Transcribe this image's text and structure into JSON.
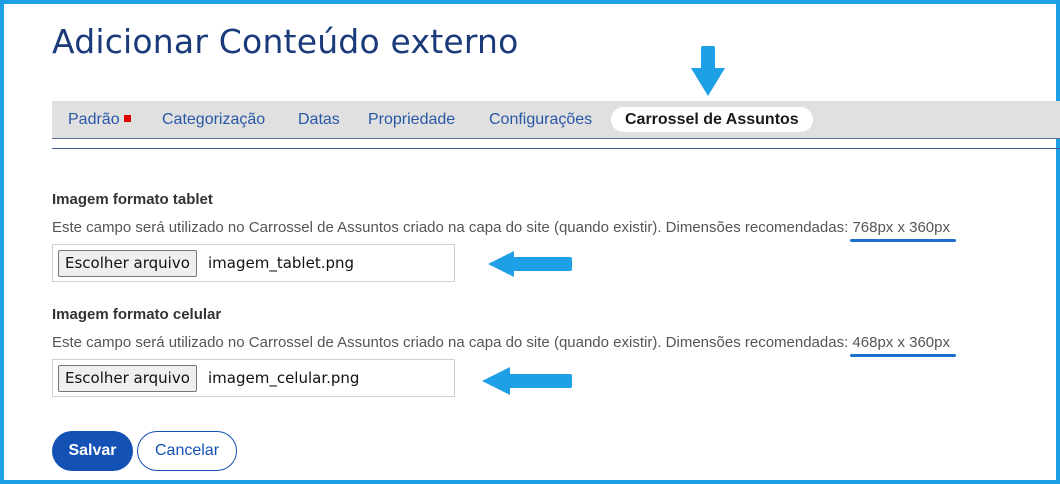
{
  "page": {
    "title": "Adicionar Conteúdo externo"
  },
  "tabs": [
    {
      "label": "Padrão",
      "required_marker": true
    },
    {
      "label": "Categorização"
    },
    {
      "label": "Datas"
    },
    {
      "label": "Propriedade"
    },
    {
      "label": "Configurações"
    },
    {
      "label": "Carrossel de Assuntos",
      "active": true
    }
  ],
  "fields": [
    {
      "label": "Imagem formato tablet",
      "help_prefix": "Este campo será utilizado no Carrossel de Assuntos criado na capa do site (quando existir). Dimensões recomendadas: ",
      "help_dimensions": "768px x 360px",
      "file_button_label": "Escolher arquivo",
      "file_name": "imagem_tablet.png"
    },
    {
      "label": "Imagem formato celular",
      "help_prefix": "Este campo será utilizado no Carrossel de Assuntos criado na capa do site (quando existir). Dimensões recomendadas: ",
      "help_dimensions": "468px x 360px",
      "file_button_label": "Escolher arquivo",
      "file_name": "imagem_celular.png"
    }
  ],
  "actions": {
    "save_label": "Salvar",
    "cancel_label": "Cancelar"
  },
  "annotations": {
    "arrow_color": "#1ea0e6",
    "underline_color": "#1a6fd0",
    "icons": [
      "arrow-down-icon",
      "arrow-left-icon"
    ]
  },
  "colors": {
    "title": "#1a3a7a",
    "tab_link": "#2858a6",
    "tab_bar": "#e0e0e0",
    "primary": "#1351b4",
    "required": "#e00000",
    "frame_border": "#1ea0e6"
  }
}
